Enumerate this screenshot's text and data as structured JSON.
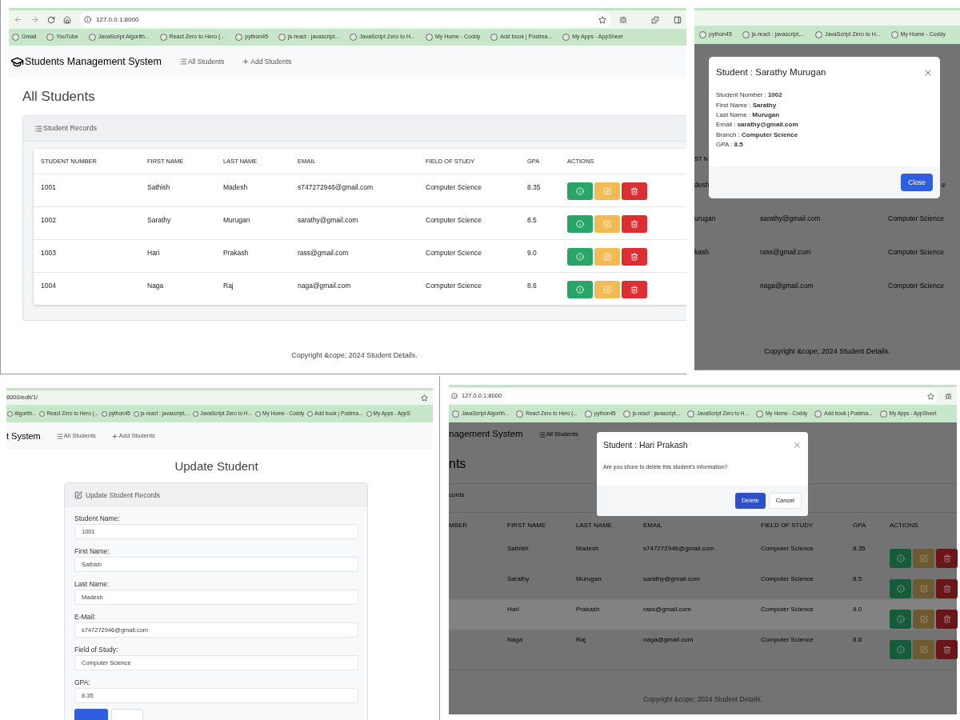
{
  "screenshots": [
    {
      "kind": "list",
      "url": "127.0.0.1:8000",
      "bookmarks": [
        "Gmail",
        "YouTube",
        "JavaScript Algorith...",
        "React Zero to Hero (...",
        "python45",
        "js-react : javascript...",
        "JavaScript Zero to H...",
        "My Home - Coddy",
        "Add book | Postma...",
        "My Apps - AppSheet"
      ],
      "brand": "Students Management System",
      "nav": [
        "All Students",
        "Add Students"
      ],
      "heading": "All Students",
      "card_title": "Student Records",
      "columns": [
        "STUDENT NUMBER",
        "FIRST NAME",
        "LAST NAME",
        "EMAIL",
        "FIELD OF STUDY",
        "GPA",
        "ACTIONS"
      ],
      "rows": [
        {
          "cells": [
            "1001",
            "Sathish",
            "Madesh",
            "s747272946@gmail.com",
            "Computer Science",
            "8.35"
          ]
        },
        {
          "cells": [
            "1002",
            "Sarathy",
            "Murugan",
            "sarathy@gmail.com",
            "Computer Science",
            "8.5"
          ]
        },
        {
          "cells": [
            "1003",
            "Hari",
            "Prakash",
            "rass@gmail.com",
            "Computer Science",
            "9.0"
          ]
        },
        {
          "cells": [
            "1004",
            "Naga",
            "Raj",
            "naga@gmail.com",
            "Computer Science",
            "8.6"
          ]
        }
      ],
      "footer": "Copyright &cope; 2024 Student Details."
    },
    {
      "kind": "detail_modal",
      "bookmarks": [
        "python45",
        "js-react : javascript,...",
        "JavaScript Zero to H...",
        "My Home - Coddy"
      ],
      "header_fragment": "ST N",
      "rows": [
        {
          "left": "desh",
          "field_tail": "e"
        },
        {
          "left": "urugan",
          "email": "sarathy@gmail.com",
          "field": "Computer Science"
        },
        {
          "left": "kash",
          "email": "rass@gmail.com",
          "field": "Computer Science"
        },
        {
          "email": "naga@gmail.com",
          "field": "Computer Science"
        }
      ],
      "footer": "Copyright &cope; 2024 Student Details.",
      "modal": {
        "title": "Student : Sarathy Murugan",
        "lines": [
          "Student Number : **1002**",
          "First Name : **Sarathy**",
          "Last Name : **Murugan**",
          "Email : **sarathy@gmail.com**",
          "Branch : **Computer Science**",
          "GPA : **8.5**"
        ],
        "button": "Close"
      }
    },
    {
      "kind": "update_form",
      "url": "8000/edit/1/",
      "bookmarks": [
        "Algorith...",
        "React Zero to Hero (...",
        "python45",
        "js-react : javascript,...",
        "JavaScript Zero to H...",
        "My Home - Coddy",
        "Add book | Postma...",
        "My Apps - AppS"
      ],
      "brand": "t System",
      "nav": [
        "All Students",
        "Add Students"
      ],
      "heading": "Update Student",
      "card_title": "Update Student Records",
      "fields": [
        {
          "label": "Student Name:",
          "value": "1001"
        },
        {
          "label": "First Name:",
          "value": "Sathish"
        },
        {
          "label": "Last Name:",
          "value": "Madesh"
        },
        {
          "label": "E-Mail:",
          "value": "s747272946@gmail.com"
        },
        {
          "label": "Field of Study:",
          "value": "Computer Science"
        },
        {
          "label": "GPA:",
          "value": "8.35"
        }
      ]
    },
    {
      "kind": "delete_modal",
      "url": "127.0.0.1:8000",
      "bookmarks": [
        "JavaScript Algorith...",
        "React Zero to Hero (...",
        "python45",
        "js-react : javascript...",
        "JavaScript Zero to H...",
        "My Home - Coddy",
        "Add book | Postma...",
        "My Apps - AppSheet"
      ],
      "brand": "nagement System",
      "nav": [
        "All Students"
      ],
      "heading": "nts",
      "card_title": "cords",
      "columns": [
        "MBER",
        "FIRST NAME",
        "LAST NAME",
        "EMAIL",
        "FIELD OF STUDY",
        "GPA",
        "ACTIONS"
      ],
      "rows": [
        {
          "cells": [
            "",
            "Sathish",
            "Madesh",
            "s747272946@gmail.com",
            "Computer Science",
            "8.35"
          ],
          "highlighted": false
        },
        {
          "cells": [
            "",
            "Sarathy",
            "Murugan",
            "sarathy@gmail.com",
            "Computer Science",
            "8.5"
          ],
          "highlighted": false
        },
        {
          "cells": [
            "",
            "Hari",
            "Prakash",
            "rass@gmail.com",
            "Computer Science",
            "9.0"
          ],
          "highlighted": true
        },
        {
          "cells": [
            "",
            "Naga",
            "Raj",
            "naga@gmail.com",
            "Computer Science",
            "8.6"
          ],
          "highlighted": false
        }
      ],
      "footer": "Copyright &cope; 2024 Student Details.",
      "modal": {
        "title": "Student : Hari Prakash",
        "message": "Are you shure to delete this student's information?",
        "buttons": [
          "Delete",
          "Cancel"
        ]
      }
    }
  ]
}
